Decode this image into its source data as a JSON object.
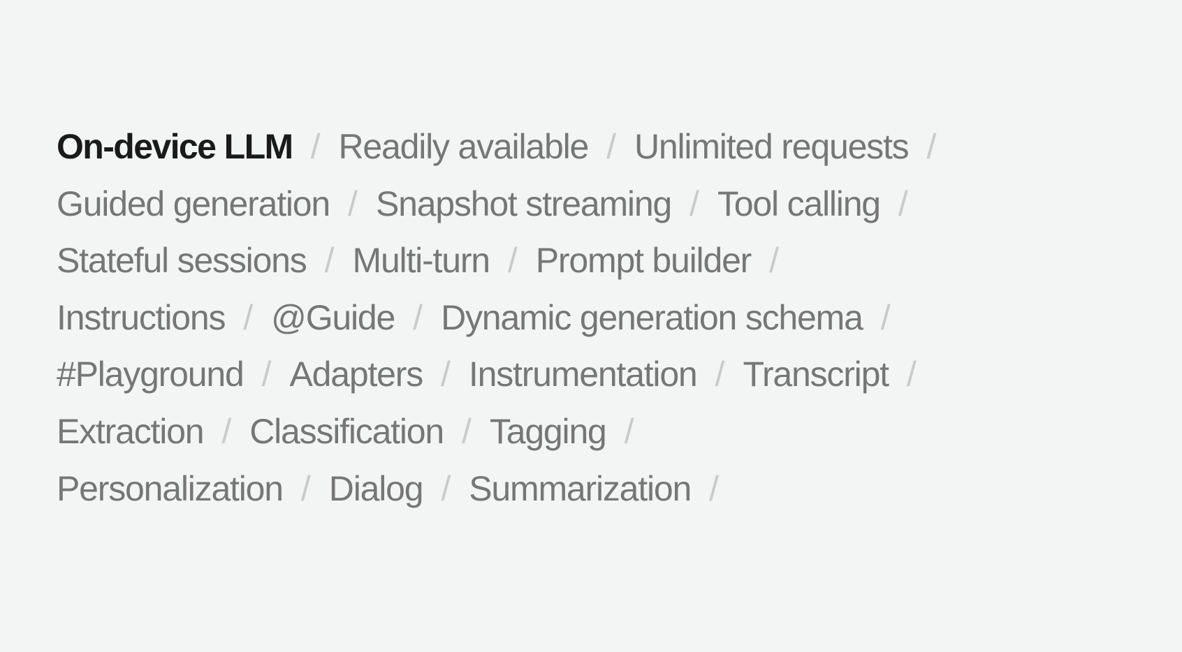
{
  "separator": "/",
  "colors": {
    "background": "#f3f4f4",
    "active": "#1a1a1a",
    "inactive": "#767676",
    "separator": "#c9cacb"
  },
  "rows": [
    {
      "terms": [
        {
          "label": "On-device LLM",
          "active": true
        },
        {
          "label": "Readily available",
          "active": false
        },
        {
          "label": "Unlimited requests",
          "active": false
        }
      ]
    },
    {
      "terms": [
        {
          "label": "Guided generation",
          "active": false
        },
        {
          "label": "Snapshot streaming",
          "active": false
        },
        {
          "label": "Tool calling",
          "active": false
        }
      ]
    },
    {
      "terms": [
        {
          "label": "Stateful sessions",
          "active": false
        },
        {
          "label": "Multi-turn",
          "active": false
        },
        {
          "label": "Prompt builder",
          "active": false
        }
      ]
    },
    {
      "terms": [
        {
          "label": "Instructions",
          "active": false
        },
        {
          "label": "@Guide",
          "active": false
        },
        {
          "label": "Dynamic generation schema",
          "active": false
        }
      ]
    },
    {
      "terms": [
        {
          "label": "#Playground",
          "active": false
        },
        {
          "label": "Adapters",
          "active": false
        },
        {
          "label": "Instrumentation",
          "active": false
        },
        {
          "label": "Transcript",
          "active": false
        }
      ]
    },
    {
      "terms": [
        {
          "label": "Extraction",
          "active": false
        },
        {
          "label": "Classification",
          "active": false
        },
        {
          "label": "Tagging",
          "active": false
        }
      ]
    },
    {
      "terms": [
        {
          "label": "Personalization",
          "active": false
        },
        {
          "label": "Dialog",
          "active": false
        },
        {
          "label": "Summarization",
          "active": false
        }
      ]
    }
  ]
}
